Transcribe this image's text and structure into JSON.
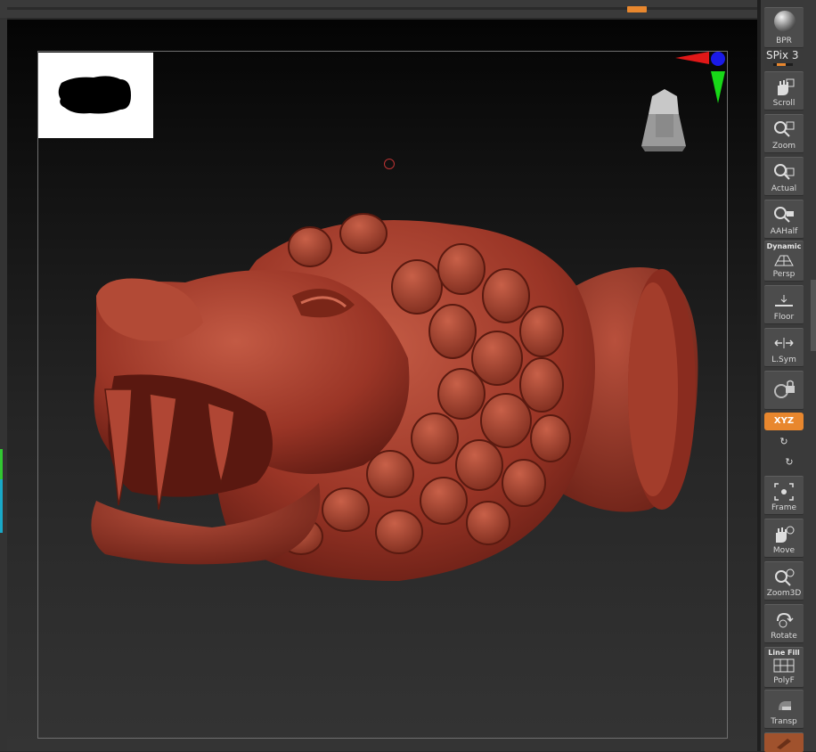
{
  "window": {
    "title": ""
  },
  "right_shelf": {
    "bpr": {
      "label": "BPR"
    },
    "spix": {
      "label": "SPix 3"
    },
    "scroll": {
      "label": "Scroll"
    },
    "zoom": {
      "label": "Zoom"
    },
    "actual": {
      "label": "Actual"
    },
    "aahalf": {
      "label": "AAHalf"
    },
    "persp": {
      "top": "Dynamic",
      "label": "Persp"
    },
    "floor": {
      "label": "Floor"
    },
    "lsym": {
      "label": "L.Sym"
    },
    "xyz": {
      "label": "XYZ"
    },
    "frame": {
      "label": "Frame"
    },
    "move": {
      "label": "Move"
    },
    "zoom3d": {
      "label": "Zoom3D"
    },
    "rotate": {
      "label": "Rotate"
    },
    "polyf": {
      "top": "Line Fill",
      "label": "PolyF"
    },
    "transp": {
      "label": "Transp"
    }
  },
  "colors": {
    "accent": "#e8872e",
    "model": "#9e3a2a",
    "panel": "#3a3a3a",
    "axis_x": "#e01818",
    "axis_y": "#18d818",
    "axis_z": "#1818e8"
  }
}
